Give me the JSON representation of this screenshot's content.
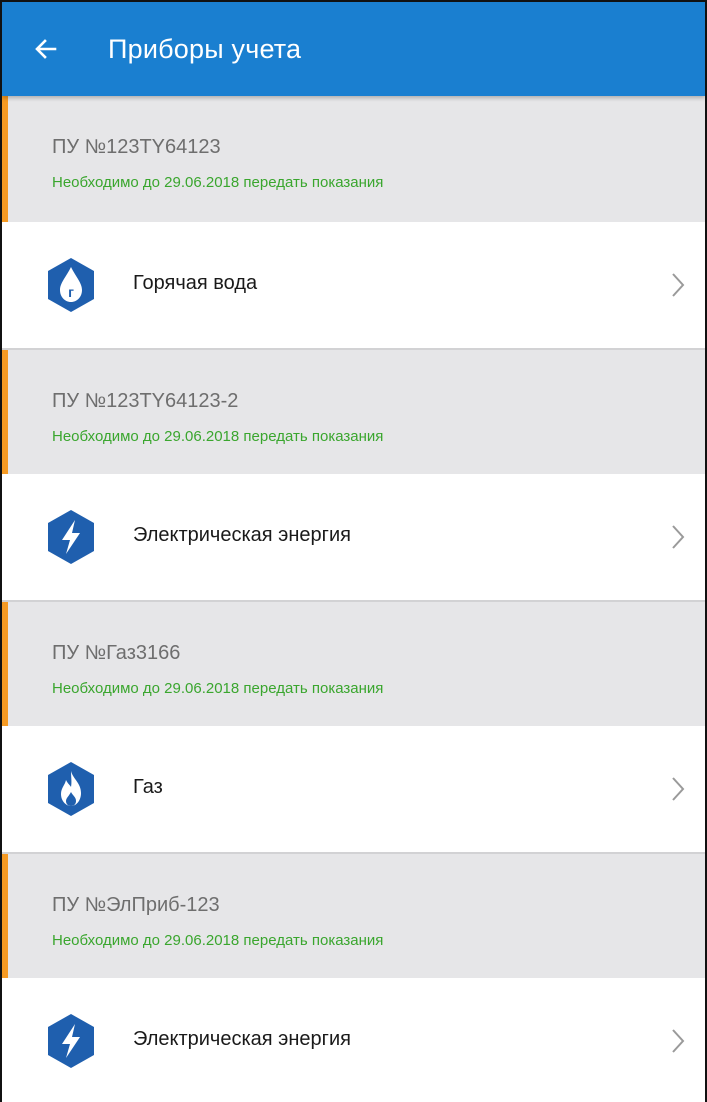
{
  "appbar": {
    "back_icon": "arrow-left-icon",
    "title": "Приборы учета"
  },
  "colors": {
    "appbar": "#1a7fd0",
    "accent_bar": "#f59a23",
    "note_text": "#3aa62e",
    "icon_fill": "#1f5fae"
  },
  "meters": [
    {
      "name": "ПУ №123TY64123",
      "note": "Необходимо до 29.06.2018 передать показания",
      "resource": {
        "label": "Горячая вода",
        "icon": "hot-water-icon"
      }
    },
    {
      "name": "ПУ №123TY64123-2",
      "note": "Необходимо до 29.06.2018 передать показания",
      "resource": {
        "label": "Электрическая энергия",
        "icon": "lightning-icon"
      }
    },
    {
      "name": "ПУ №Газ3166",
      "note": "Необходимо до 29.06.2018 передать показания",
      "resource": {
        "label": "Газ",
        "icon": "flame-icon"
      }
    },
    {
      "name": "ПУ №ЭлПриб-123",
      "note": "Необходимо до 29.06.2018 передать показания",
      "resource": {
        "label": "Электрическая энергия",
        "icon": "lightning-icon"
      }
    }
  ]
}
